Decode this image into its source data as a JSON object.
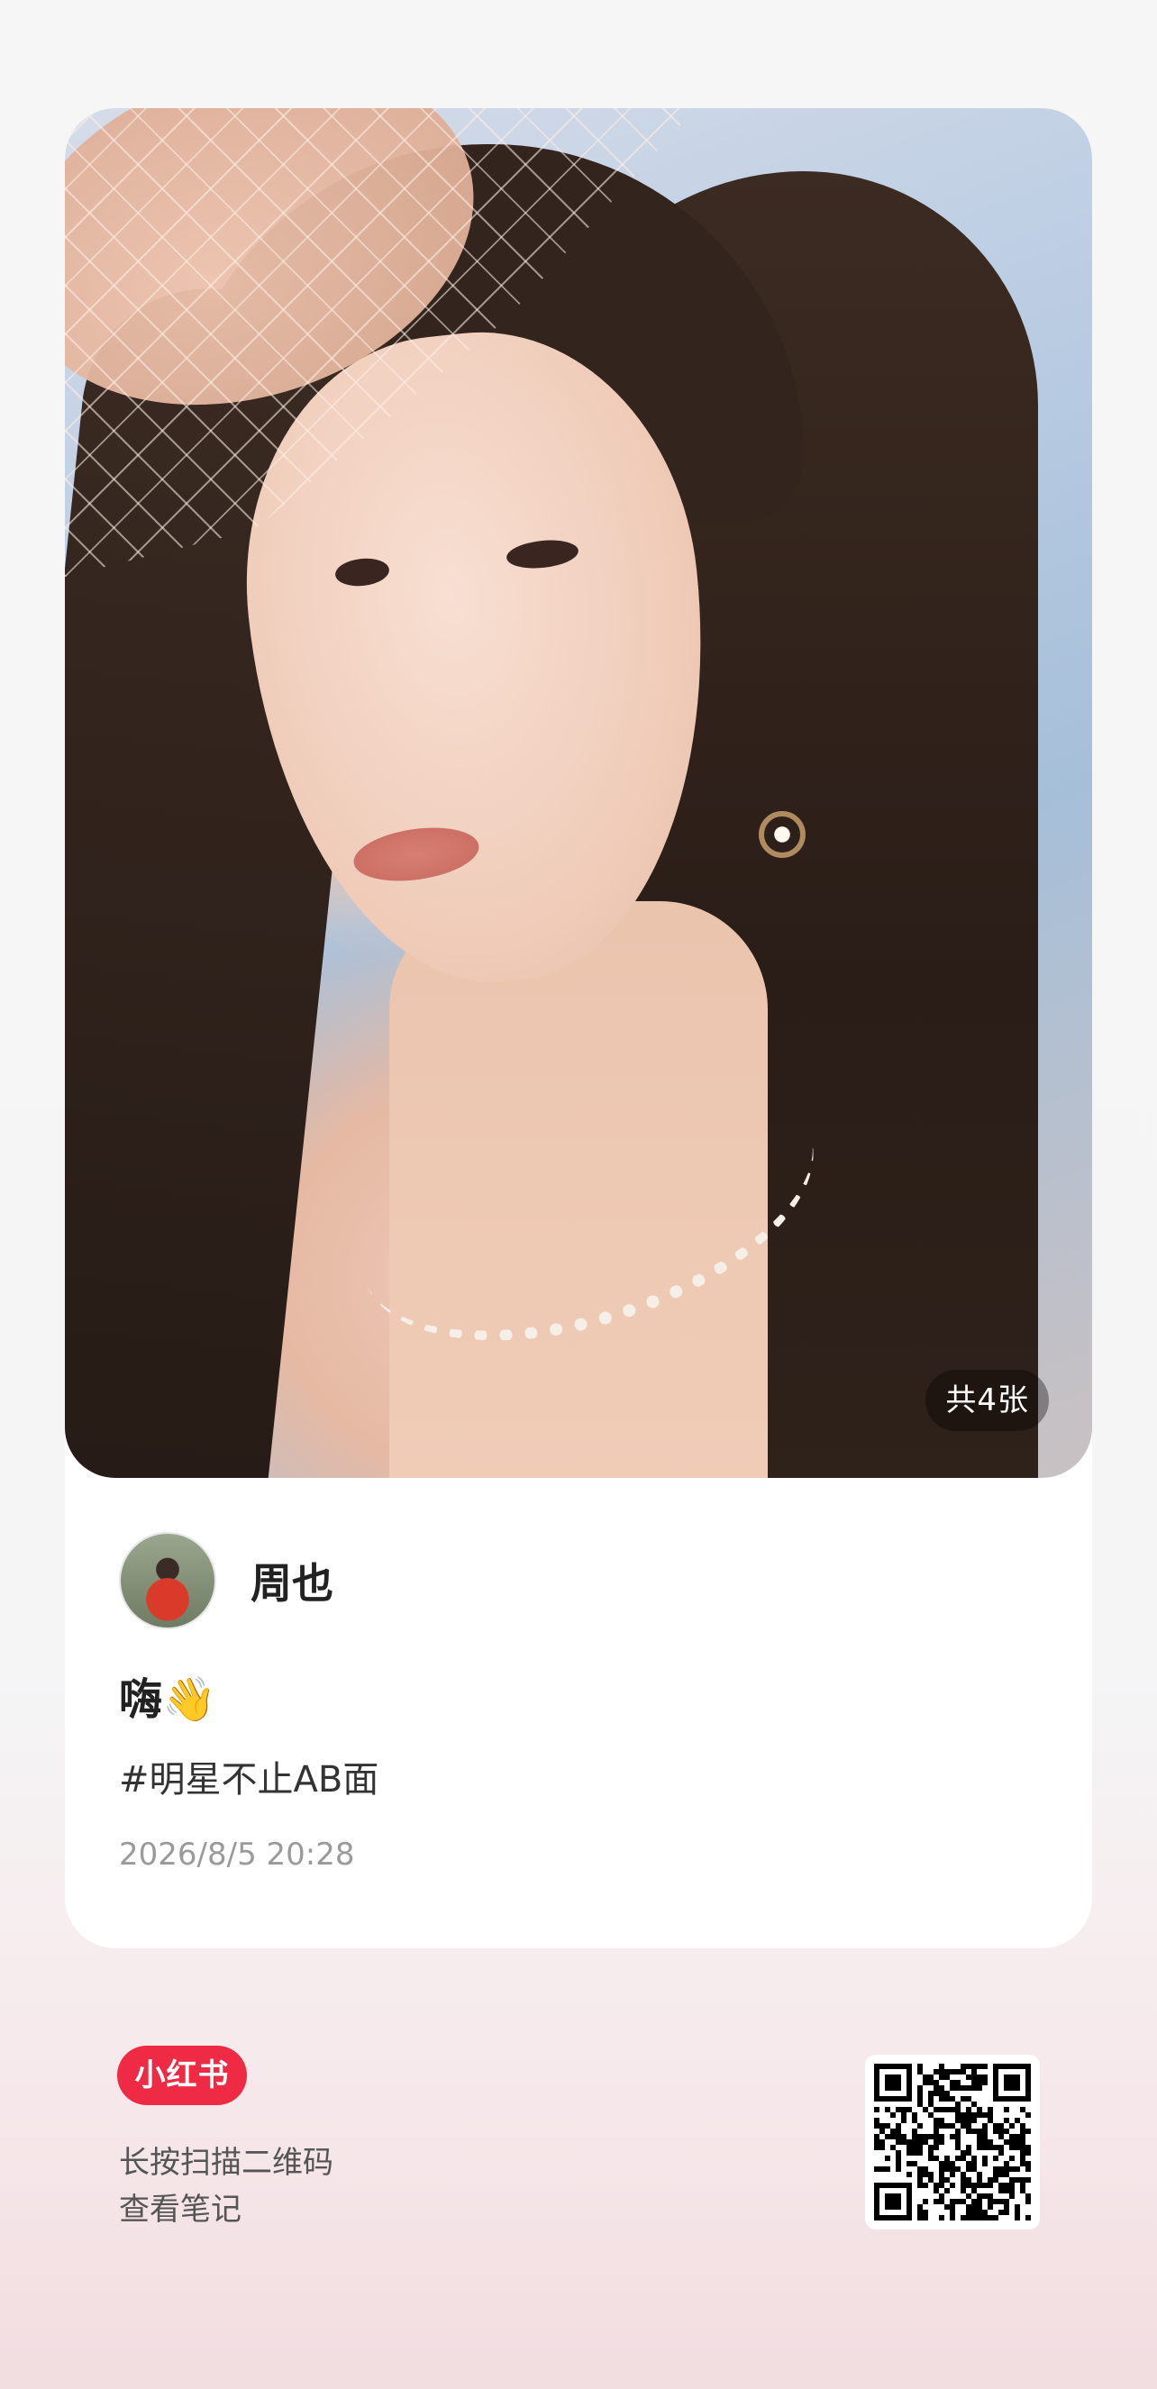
{
  "post": {
    "image_count_label": "共4张",
    "author_name": "周也",
    "title": "嗨👋",
    "tag": "#明星不止AB面",
    "date": "2026/8/5 20:28"
  },
  "footer": {
    "brand": "小红书",
    "hint_line1": "长按扫描二维码",
    "hint_line2": "查看笔记"
  },
  "colors": {
    "brand_red": "#ee2a44",
    "date_gray": "#9a9a9a"
  },
  "icons": {
    "avatar": "user-avatar",
    "qr": "qr-code-icon"
  }
}
